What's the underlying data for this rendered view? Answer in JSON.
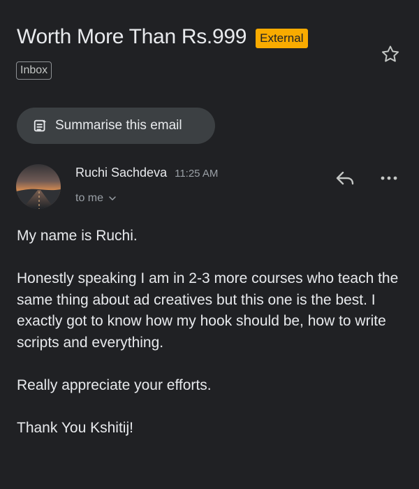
{
  "email": {
    "subject": "Worth More Than Rs.999",
    "external_badge": "External",
    "label": "Inbox",
    "summarise_label": "Summarise this email",
    "sender_name": "Ruchi Sachdeva",
    "time": "11:25 AM",
    "recipient": "to me",
    "body": [
      "My name is Ruchi.",
      "Honestly speaking I am in 2-3 more courses who teach the same thing about ad creatives but this one is the best. I exactly got to know how my hook should be, how to write scripts and everything.",
      "Really appreciate your efforts.",
      "Thank You Kshitij!"
    ]
  },
  "icons": {
    "star": "star-outline",
    "summarise": "summary-spark-document",
    "reply": "reply-arrow",
    "more": "more-horizontal",
    "recipient_menu": "chevron-down"
  },
  "colors": {
    "background": "#202124",
    "text": "#e8eaed",
    "secondary_text": "#9aa0a6",
    "external_badge": "#f9ab00",
    "summary_pill": "#3c4043"
  }
}
